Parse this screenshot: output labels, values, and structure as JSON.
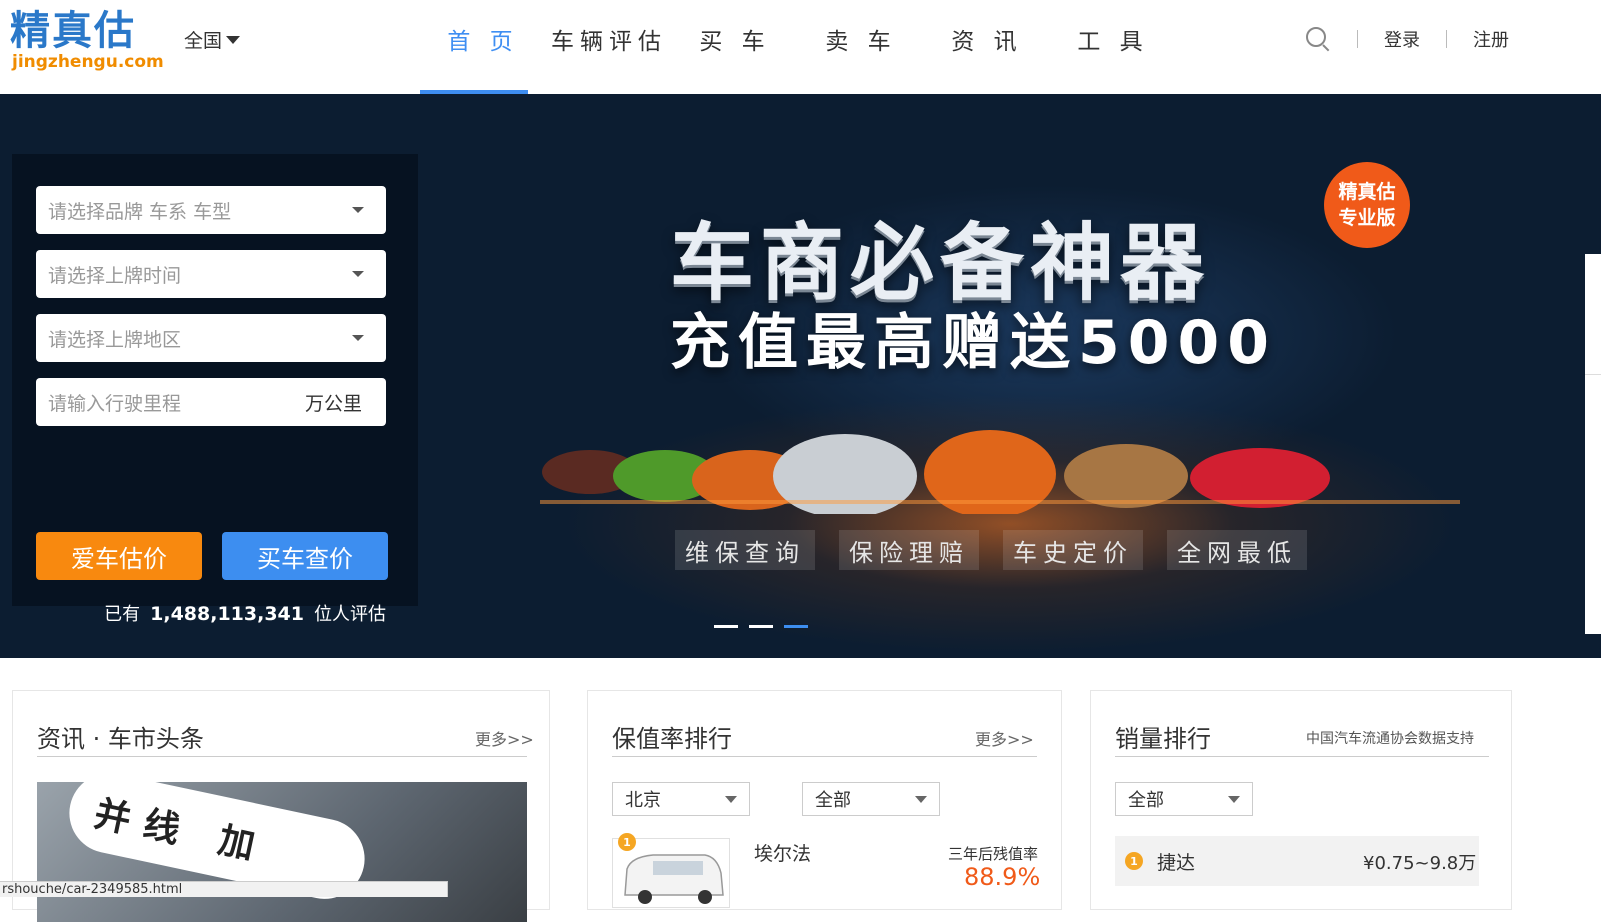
{
  "header": {
    "logo_text": "精真估",
    "logo_domain": "jingzhengu.com",
    "city": "全国",
    "nav": [
      {
        "label": "首 页",
        "active": true
      },
      {
        "label": "车辆评估",
        "active": false
      },
      {
        "label": "买 车",
        "active": false
      },
      {
        "label": "卖 车",
        "active": false
      },
      {
        "label": "资 讯",
        "active": false
      },
      {
        "label": "工 具",
        "active": false
      }
    ],
    "login": "登录",
    "register": "注册",
    "search_icon": "search-icon"
  },
  "eval_form": {
    "brand_placeholder": "请选择品牌 车系 车型",
    "date_placeholder": "请选择上牌时间",
    "region_placeholder": "请选择上牌地区",
    "mileage_placeholder": "请输入行驶里程",
    "mileage_unit": "万公里",
    "btn_evaluate": "爱车估价",
    "btn_buy": "买车查价",
    "count_prefix": "已有",
    "count_value": "1,488,113,341",
    "count_suffix": "位人评估"
  },
  "banner": {
    "title": "车商必备神器",
    "subtitle": "充值最高赠送5000",
    "badge_line1": "精真估",
    "badge_line2": "专业版",
    "features": [
      "维保查询",
      "保险理赔",
      "车史定价",
      "全网最低"
    ],
    "slides": 3,
    "active_slide": 3
  },
  "news_card": {
    "title": "资讯 · 车市头条",
    "more": "更多>>",
    "image_text": "并线 加"
  },
  "value_card": {
    "title": "保值率排行",
    "more": "更多>>",
    "city_select": "北京",
    "type_select": "全部",
    "top_item": {
      "rank": "1",
      "name": "埃尔法",
      "label": "三年后残值率",
      "value": "88.9%"
    }
  },
  "sales_card": {
    "title": "销量排行",
    "note": "中国汽车流通协会数据支持",
    "select": "全部",
    "top_item": {
      "rank": "1",
      "name": "捷达",
      "price": "¥0.75~9.8万"
    }
  },
  "status_bar": {
    "url": "rshouche/car-2349585.html"
  },
  "colors": {
    "brand_blue": "#2a78c9",
    "accent_blue": "#3e8ef2",
    "accent_orange": "#f8890f",
    "banner_bg": "#0c1d31",
    "highlight_red": "#f05a19"
  }
}
